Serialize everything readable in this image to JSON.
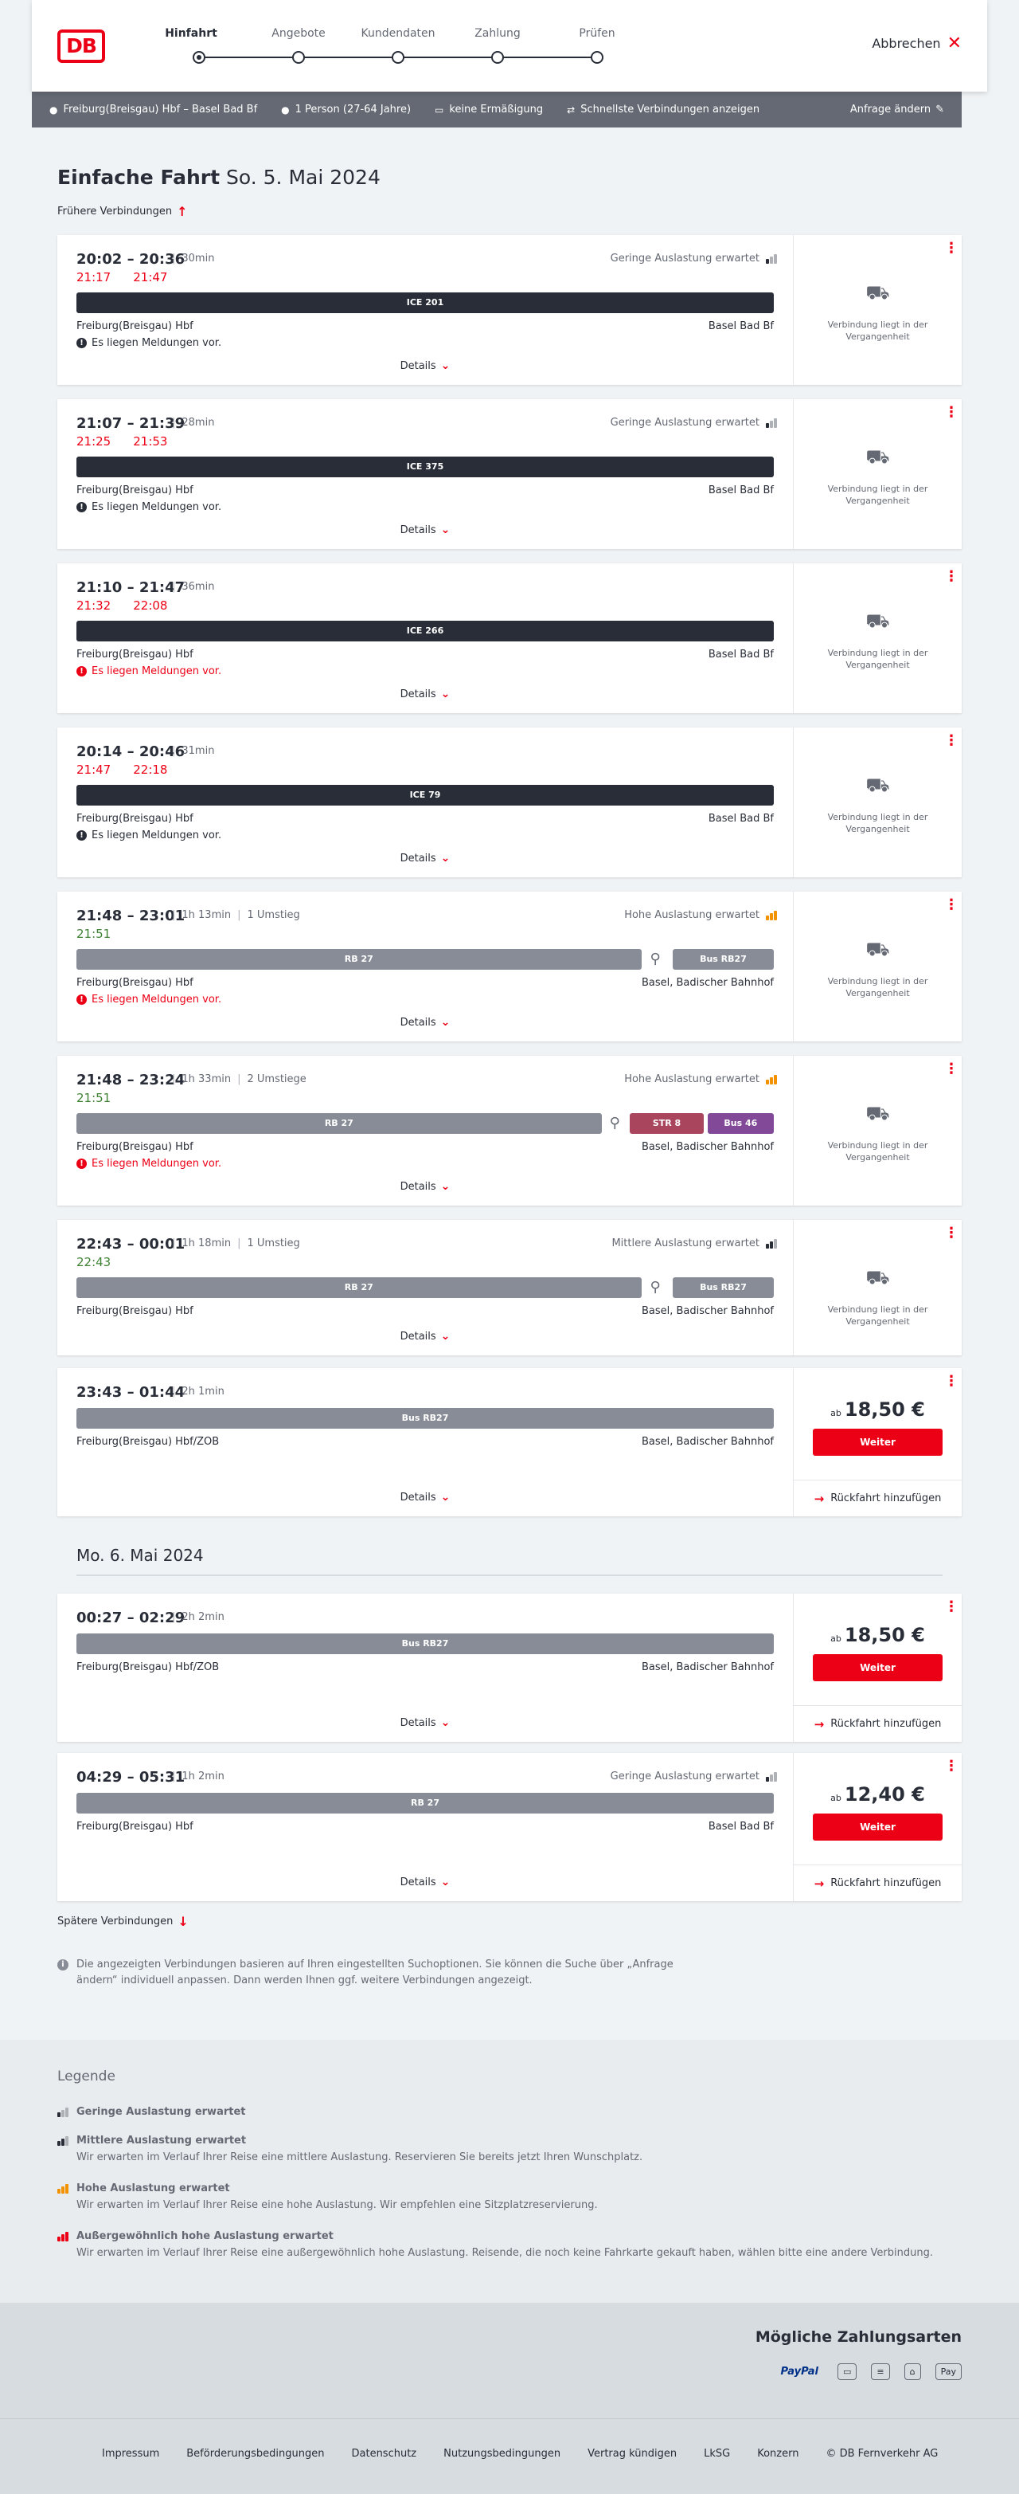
{
  "header": {
    "logo": "DB",
    "steps": [
      {
        "label": "Hinfahrt",
        "active": true
      },
      {
        "label": "Angebote",
        "active": false
      },
      {
        "label": "Kundendaten",
        "active": false
      },
      {
        "label": "Zahlung",
        "active": false
      },
      {
        "label": "Prüfen",
        "active": false
      }
    ],
    "cancel_label": "Abbrechen"
  },
  "query": {
    "route": "Freiburg(Breisgau) Hbf – Basel Bad Bf",
    "persons": "1 Person (27-64 Jahre)",
    "discount": "keine Ermäßigung",
    "fastest": "Schnellste Verbindungen anzeigen",
    "change_label": "Anfrage ändern"
  },
  "page": {
    "title": "Einfache Fahrt",
    "date": "So. 5. Mai 2024",
    "earlier_label": "Frühere Verbindungen",
    "later_label": "Spätere Verbindungen",
    "day2": "Mo. 6. Mai 2024",
    "note": "Die angezeigten Verbindungen basieren auf Ihren eingestellten Suchoptionen. Sie können die Suche über „Anfrage ändern“ individuell anpassen. Dann werden Ihnen ggf. weitere Verbindungen angezeigt."
  },
  "common": {
    "details_label": "Details",
    "past_text": "Verbindung liegt in der Vergangenheit",
    "weiter_label": "Weiter",
    "return_label": "Rückfahrt hinzufügen",
    "price_prefix": "ab"
  },
  "connections": [
    {
      "times": "20:02 – 20:36",
      "duration": "30min",
      "transfers": "",
      "load": "Geringe Auslastung erwartet",
      "load_level": 1,
      "rt": [
        {
          "t": "21:17",
          "c": "red"
        },
        {
          "t": "21:47",
          "c": "red"
        }
      ],
      "bars": [
        {
          "label": "ICE 201",
          "style": "dark",
          "start": 0,
          "end": 1
        }
      ],
      "from": "Freiburg(Breisgau) Hbf",
      "to": "Basel Bad Bf",
      "msg": "Es liegen Meldungen vor.",
      "msg_red": false,
      "past": true,
      "price": ""
    },
    {
      "times": "21:07 – 21:39",
      "duration": "28min",
      "transfers": "",
      "load": "Geringe Auslastung erwartet",
      "load_level": 1,
      "rt": [
        {
          "t": "21:25",
          "c": "red"
        },
        {
          "t": "21:53",
          "c": "red"
        }
      ],
      "bars": [
        {
          "label": "ICE 375",
          "style": "dark",
          "start": 0,
          "end": 1
        }
      ],
      "from": "Freiburg(Breisgau) Hbf",
      "to": "Basel Bad Bf",
      "msg": "Es liegen Meldungen vor.",
      "msg_red": false,
      "past": true,
      "price": ""
    },
    {
      "times": "21:10 – 21:47",
      "duration": "36min",
      "transfers": "",
      "load": "",
      "load_level": 0,
      "rt": [
        {
          "t": "21:32",
          "c": "red"
        },
        {
          "t": "22:08",
          "c": "red"
        }
      ],
      "bars": [
        {
          "label": "ICE 266",
          "style": "dark",
          "start": 0,
          "end": 1
        }
      ],
      "from": "Freiburg(Breisgau) Hbf",
      "to": "Basel Bad Bf",
      "msg": "Es liegen Meldungen vor.",
      "msg_red": true,
      "past": true,
      "price": ""
    },
    {
      "times": "20:14 – 20:46",
      "duration": "31min",
      "transfers": "",
      "load": "",
      "load_level": 0,
      "rt": [
        {
          "t": "21:47",
          "c": "red"
        },
        {
          "t": "22:18",
          "c": "red"
        }
      ],
      "bars": [
        {
          "label": "ICE 79",
          "style": "dark",
          "start": 0,
          "end": 1
        }
      ],
      "from": "Freiburg(Breisgau) Hbf",
      "to": "Basel Bad Bf",
      "msg": "Es liegen Meldungen vor.",
      "msg_red": false,
      "past": true,
      "price": ""
    },
    {
      "times": "21:48 – 23:01",
      "duration": "1h 13min",
      "transfers": "1 Umstieg",
      "load": "Hohe Auslastung erwartet",
      "load_level": 3,
      "rt": [
        {
          "t": "21:51",
          "c": "green"
        }
      ],
      "bars": [
        {
          "label": "RB 27",
          "style": "grey",
          "start": 0,
          "end": 0.81
        },
        {
          "label": "Bus RB27",
          "style": "grey",
          "start": 0.855,
          "end": 1
        }
      ],
      "walk_at": 0.83,
      "from": "Freiburg(Breisgau) Hbf",
      "to": "Basel, Badischer Bahnhof",
      "msg": "Es liegen Meldungen vor.",
      "msg_red": true,
      "past": true,
      "price": ""
    },
    {
      "times": "21:48 – 23:24",
      "duration": "1h 33min",
      "transfers": "2 Umstiege",
      "load": "Hohe Auslastung erwartet",
      "load_level": 3,
      "rt": [
        {
          "t": "21:51",
          "c": "green"
        }
      ],
      "bars": [
        {
          "label": "RB 27",
          "style": "grey",
          "start": 0,
          "end": 0.753
        },
        {
          "label": "STR 8",
          "style": "str",
          "start": 0.793,
          "end": 0.9
        },
        {
          "label": "Bus 46",
          "style": "bus46",
          "start": 0.905,
          "end": 1
        }
      ],
      "walk_at": 0.772,
      "from": "Freiburg(Breisgau) Hbf",
      "to": "Basel, Badischer Bahnhof",
      "msg": "Es liegen Meldungen vor.",
      "msg_red": true,
      "past": true,
      "price": ""
    },
    {
      "times": "22:43 – 00:01",
      "duration": "1h 18min",
      "transfers": "1 Umstieg",
      "load": "Mittlere Auslastung erwartet",
      "load_level": 2,
      "rt": [
        {
          "t": "22:43",
          "c": "green"
        }
      ],
      "bars": [
        {
          "label": "RB 27",
          "style": "grey",
          "start": 0,
          "end": 0.81
        },
        {
          "label": "Bus RB27",
          "style": "grey",
          "start": 0.855,
          "end": 1
        }
      ],
      "walk_at": 0.83,
      "from": "Freiburg(Breisgau) Hbf",
      "to": "Basel, Badischer Bahnhof",
      "msg": "",
      "msg_red": false,
      "past": true,
      "price": ""
    },
    {
      "times": "23:43 – 01:44",
      "duration": "2h 1min",
      "transfers": "",
      "load": "",
      "load_level": 0,
      "rt": [],
      "bars": [
        {
          "label": "Bus RB27",
          "style": "grey",
          "start": 0,
          "end": 1
        }
      ],
      "from": "Freiburg(Breisgau) Hbf/ZOB",
      "to": "Basel, Badischer Bahnhof",
      "msg": "",
      "msg_red": false,
      "past": false,
      "price": "18,50 €"
    },
    {
      "times": "00:27 – 02:29",
      "duration": "2h 2min",
      "transfers": "",
      "load": "",
      "load_level": 0,
      "rt": [],
      "bars": [
        {
          "label": "Bus RB27",
          "style": "grey",
          "start": 0,
          "end": 1
        }
      ],
      "from": "Freiburg(Breisgau) Hbf/ZOB",
      "to": "Basel, Badischer Bahnhof",
      "msg": "",
      "msg_red": false,
      "past": false,
      "price": "18,50 €"
    },
    {
      "times": "04:29 – 05:31",
      "duration": "1h 2min",
      "transfers": "",
      "load": "Geringe Auslastung erwartet",
      "load_level": 1,
      "rt": [],
      "bars": [
        {
          "label": "RB 27",
          "style": "grey",
          "start": 0,
          "end": 1
        }
      ],
      "from": "Freiburg(Breisgau) Hbf",
      "to": "Basel Bad Bf",
      "msg": "",
      "msg_red": false,
      "past": false,
      "price": "12,40 €"
    }
  ],
  "legend": {
    "title": "Legende",
    "items": [
      {
        "title": "Geringe Auslastung erwartet",
        "level": 1,
        "text": ""
      },
      {
        "title": "Mittlere Auslastung erwartet",
        "level": 2,
        "text": "Wir erwarten im Verlauf Ihrer Reise eine mittlere Auslastung. Reservieren Sie bereits jetzt Ihren Wunschplatz."
      },
      {
        "title": "Hohe Auslastung erwartet",
        "level": 3,
        "text": "Wir erwarten im Verlauf Ihrer Reise eine hohe Auslastung. Wir empfehlen eine Sitzplatzreservierung."
      },
      {
        "title": "Außergewöhnlich hohe Auslastung erwartet",
        "level": 4,
        "text": "Wir erwarten im Verlauf Ihrer Reise eine außergewöhnlich hohe Auslastung. Reisende, die noch keine Fahrkarte gekauft haben, wählen bitte eine andere Verbindung."
      }
    ]
  },
  "payment": {
    "title": "Mögliche Zahlungsarten",
    "methods": [
      "PayPal",
      "Kreditkarte",
      "Lastschrift",
      "giropay",
      "Apple Pay"
    ]
  },
  "footer": {
    "links": [
      "Impressum",
      "Beförderungsbedingungen",
      "Datenschutz",
      "Nutzungsbedingungen",
      "Vertrag kündigen",
      "LkSG",
      "Konzern",
      "© DB Fernverkehr AG"
    ]
  },
  "colors": {
    "accent": "#ec0016",
    "dark": "#282d37",
    "grey_bar": "#878c96",
    "delay": "#ec0016",
    "ontime": "#408335"
  }
}
